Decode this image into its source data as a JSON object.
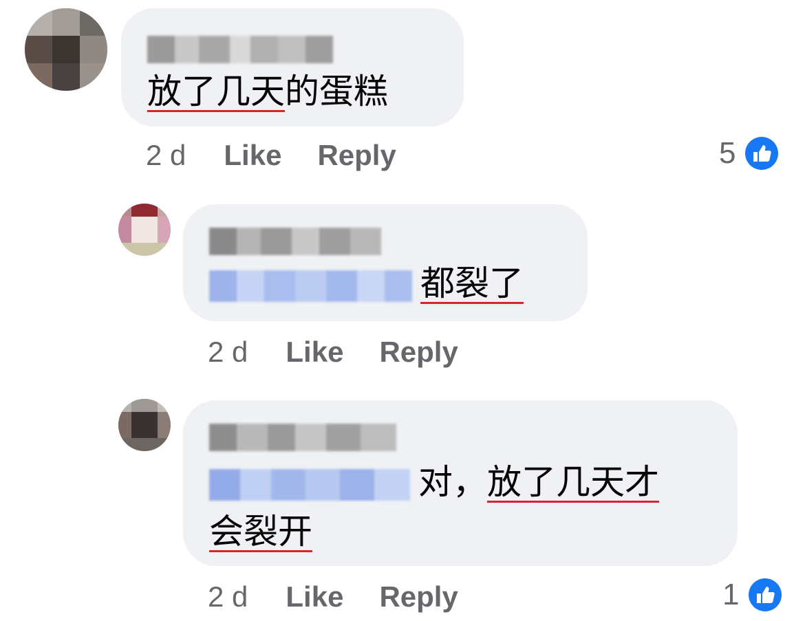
{
  "colors": {
    "bubble": "#eff1f4",
    "text": "#050505",
    "meta": "#65676b",
    "like_blue": "#1877f2",
    "underline_red": "#d3262a"
  },
  "comments": [
    {
      "segments": [
        {
          "text": "放了几天",
          "underline": true
        },
        {
          "text": "的蛋糕",
          "underline": false
        }
      ],
      "time": "2 d",
      "like_label": "Like",
      "reply_label": "Reply",
      "reaction_count": "5",
      "reaction_icon": "like-icon"
    },
    {
      "segments": [
        {
          "text": "都裂了",
          "underline": true
        }
      ],
      "time": "2 d",
      "like_label": "Like",
      "reply_label": "Reply"
    },
    {
      "line1_segments": [
        {
          "text": "对，",
          "underline": false
        },
        {
          "text": "放了几天才",
          "underline": true
        }
      ],
      "line2_segments": [
        {
          "text": "会裂开",
          "underline": true
        }
      ],
      "time": "2 d",
      "like_label": "Like",
      "reply_label": "Reply",
      "reaction_count": "1",
      "reaction_icon": "like-icon"
    }
  ]
}
